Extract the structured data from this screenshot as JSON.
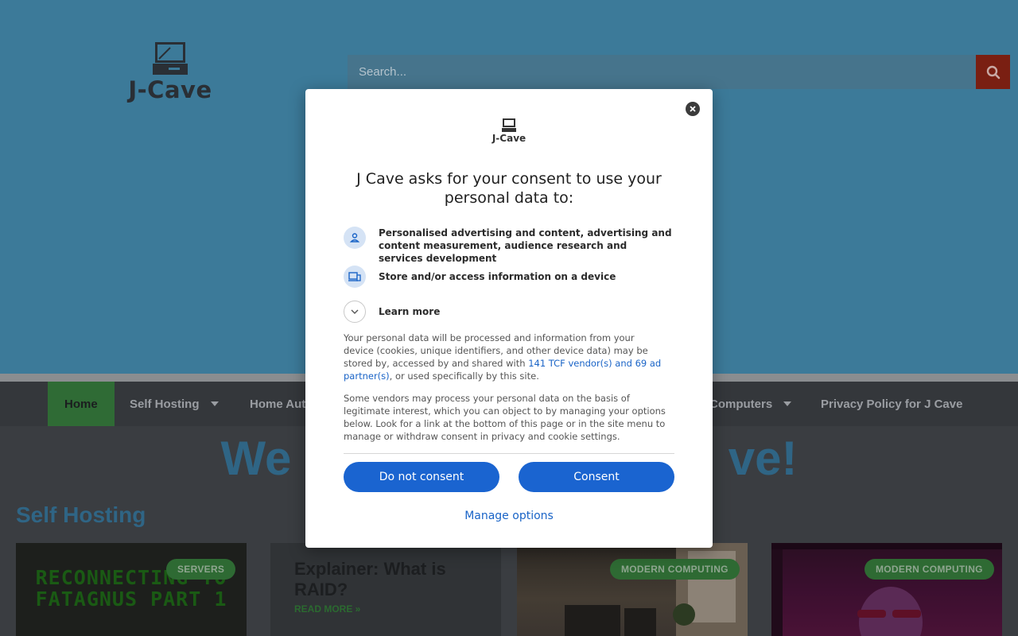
{
  "site": {
    "logo_text": "J-Cave",
    "search_placeholder": "Search..."
  },
  "nav": {
    "items": [
      {
        "label": "Home",
        "active": true
      },
      {
        "label": "Self Hosting",
        "dropdown": true
      },
      {
        "label": "Home Auto"
      },
      {
        "label": "Computers",
        "dropdown": true
      },
      {
        "label": "Privacy Policy for J Cave"
      }
    ]
  },
  "page": {
    "welcome_left": "We",
    "welcome_right": "ve!",
    "section_title": "Self Hosting"
  },
  "cards": [
    {
      "badge": "SERVERS",
      "art_text": "RECONNECTING TO FATAGNUS PART 1"
    },
    {
      "title": "Explainer: What is RAID?",
      "read_more": "READ MORE »"
    },
    {
      "badge": "MODERN COMPUTING"
    },
    {
      "badge": "MODERN COMPUTING"
    }
  ],
  "consent": {
    "logo_text": "J-Cave",
    "title": "J Cave asks for your consent to use your personal data to:",
    "purposes": [
      {
        "icon": "person-icon",
        "text": "Personalised advertising and content, advertising and content measurement, audience research and services development"
      },
      {
        "icon": "devices-icon",
        "text": "Store and/or access information on a device"
      },
      {
        "icon": "chevron-down-icon",
        "text": "Learn more"
      }
    ],
    "para1_a": "Your personal data will be processed and information from your device (cookies, unique identifiers, and other device data) may be stored by, accessed by and shared with ",
    "para1_link": "141 TCF vendor(s) and 69 ad partner(s)",
    "para1_b": ", or used specifically by this site.",
    "para2": "Some vendors may process your personal data on the basis of legitimate interest, which you can object to by managing your options below. Look for a link at the bottom of this page or in the site menu to manage or withdraw consent in privacy and cookie settings.",
    "do_not_consent": "Do not consent",
    "consent": "Consent",
    "manage_options": "Manage options"
  },
  "colors": {
    "hero_bg": "#3c7a99",
    "accent_green": "#2f6b35",
    "dialog_button": "#1a64d0",
    "link": "#1a64c7"
  }
}
